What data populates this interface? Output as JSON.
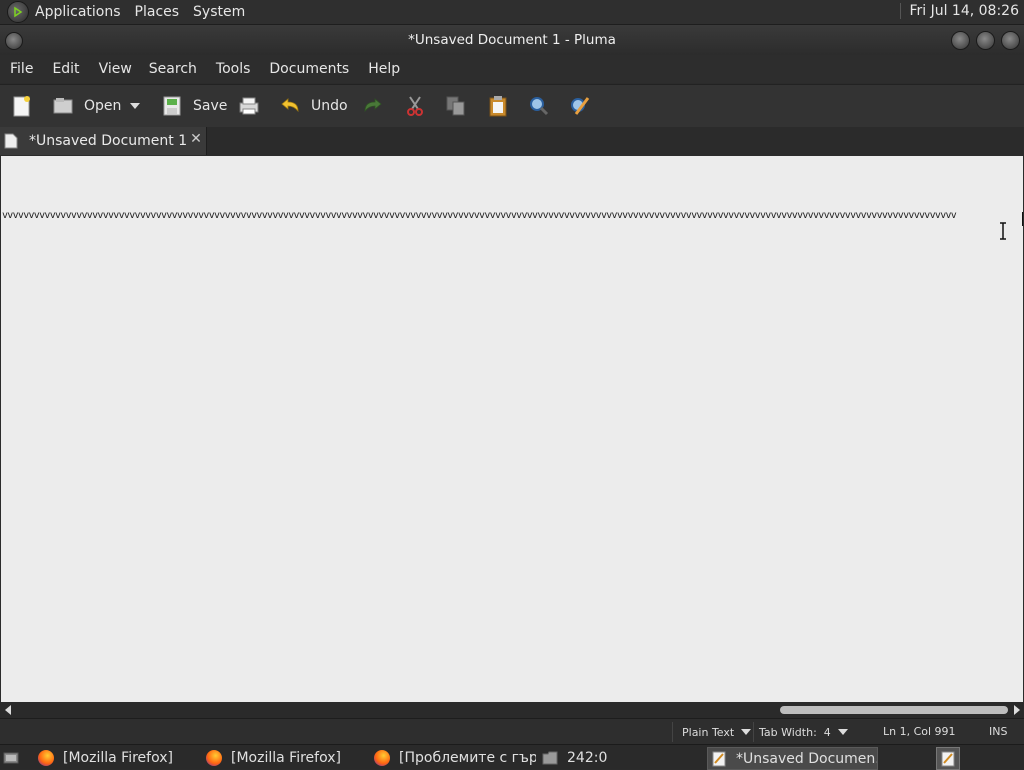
{
  "top_panel": {
    "menus": [
      "Applications",
      "Places",
      "System"
    ],
    "clock": "Fri Jul 14, 08:26"
  },
  "window": {
    "title": "*Unsaved Document 1 - Pluma"
  },
  "menubar": [
    "File",
    "Edit",
    "View",
    "Search",
    "Tools",
    "Documents",
    "Help"
  ],
  "toolbar": {
    "new_icon": "new-document-icon",
    "open_label": "Open",
    "save_label": "Save",
    "undo_label": "Undo"
  },
  "tab": {
    "title": "*Unsaved Document 1",
    "close_glyph": "✕"
  },
  "editor": {
    "line_text": "vvvvvvvvvvvvvvvvvvvvvvvvvvvvvvvvvvvvvvvvvvvvvvvvvvvvvvvvvvvvvvvvvvvvvvvvvvvvvvvvvvvvvvvvvvvvvvvvvvvvvvvvvvvvvvvvvvvvvvvvvvvvvvvvvvvvvvvvvvvvvvvvvvvvvvvvvvvvvvvvvvvvvvvvvvvvvvvvvvvv"
  },
  "statusbar": {
    "language": "Plain Text",
    "tab_width": "Tab Width:  4",
    "position": "Ln 1, Col 991",
    "mode": "INS"
  },
  "taskbar": {
    "items": [
      {
        "label": "[Mozilla Firefox]",
        "icon": "firefox-icon"
      },
      {
        "label": "[Mozilla Firefox]",
        "icon": "firefox-icon"
      },
      {
        "label": "[Проблемите с гър…",
        "icon": "firefox-icon"
      },
      {
        "label": "242:0",
        "icon": "folder-icon"
      },
      {
        "label": "*Unsaved Documen…",
        "icon": "text-editor-icon"
      }
    ]
  }
}
